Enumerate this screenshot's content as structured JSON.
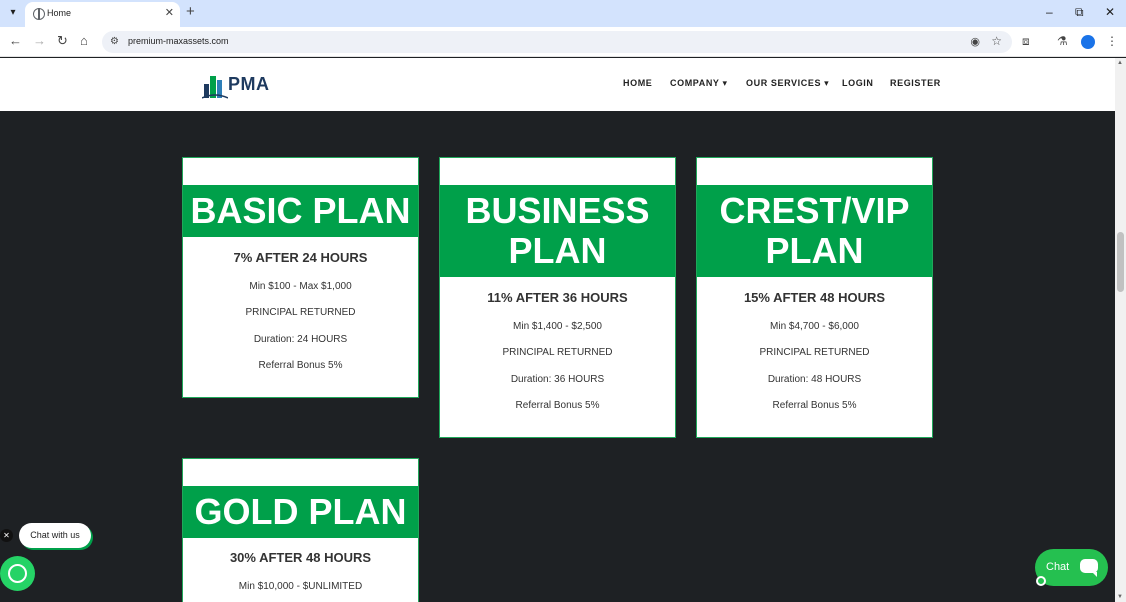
{
  "browser": {
    "tab_title": "Home",
    "url": "premium-maxassets.com"
  },
  "site": {
    "logo_text": "PMA",
    "nav": {
      "home": "HOME",
      "company": "COMPANY",
      "services": "OUR SERVICES",
      "login": "LOGIN",
      "register": "REGISTER"
    }
  },
  "plans": [
    {
      "name": "BASIC PLAN",
      "rate": "7% AFTER 24 HOURS",
      "range": "Min $100 - Max $1,000",
      "principal": "PRINCIPAL RETURNED",
      "duration": "Duration: 24 HOURS",
      "referral": "Referral Bonus 5%"
    },
    {
      "name_line1": "BUSINESS",
      "name_line2": "PLAN",
      "rate": "11% AFTER 36 HOURS",
      "range": "Min $1,400 - $2,500",
      "principal": "PRINCIPAL RETURNED",
      "duration": "Duration: 36 HOURS",
      "referral": "Referral Bonus 5%"
    },
    {
      "name_line1": "CREST/VIP",
      "name_line2": "PLAN",
      "rate": "15% AFTER 48 HOURS",
      "range": "Min $4,700 - $6,000",
      "principal": "PRINCIPAL RETURNED",
      "duration": "Duration: 48 HOURS",
      "referral": "Referral Bonus 5%"
    },
    {
      "name": "GOLD PLAN",
      "rate": "30% AFTER 48 HOURS",
      "range": "Min $10,000 - $UNLIMITED"
    }
  ],
  "chat": {
    "bubble_text": "Chat with us",
    "button_label": "Chat"
  },
  "colors": {
    "accent_green": "#00a04a",
    "page_bg": "#1e2124"
  }
}
